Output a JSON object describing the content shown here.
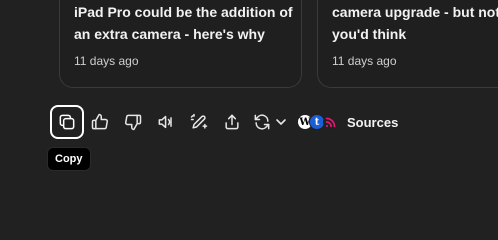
{
  "cards": [
    {
      "title_line1": "iPad Pro could be the addition of",
      "title_line2": "an extra camera - here's why",
      "date": "11 days ago"
    },
    {
      "title_line1": "camera upgrade - but not",
      "title_line2": "you'd think",
      "date": "11 days ago"
    }
  ],
  "toolbar": {
    "copy_icon": "copy-icon",
    "like_icon": "thumbs-up-icon",
    "dislike_icon": "thumbs-down-icon",
    "read_aloud_icon": "speaker-icon",
    "edit_icon": "pen-icon",
    "share_icon": "share-icon",
    "regenerate_icon": "refresh-icon",
    "sources_label": "Sources",
    "source_icons": [
      "W",
      "t",
      "rss"
    ]
  },
  "tooltip": {
    "text": "Copy"
  },
  "colors": {
    "background": "#212121",
    "card_border": "#3a3a3a",
    "text": "#f2f2f2",
    "tooltip_bg": "#000000",
    "source_blue": "#1b5fd6",
    "source_pink": "#e2186f"
  }
}
